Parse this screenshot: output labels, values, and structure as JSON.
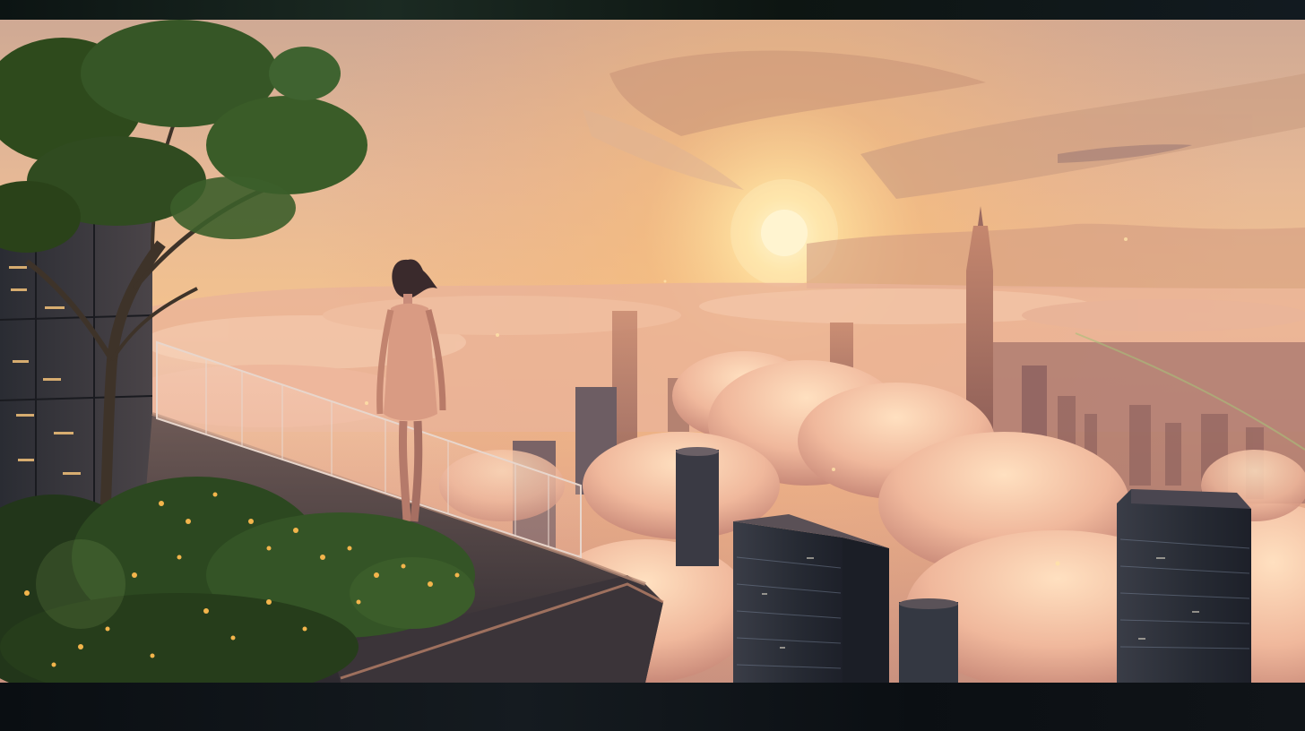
{
  "image": {
    "kind": "illustration",
    "colors": {
      "sky_top": "#d9b39a",
      "sky_glow": "#f6c27a",
      "sun": "#fff3c9",
      "cloud": "#f1c2a4",
      "cloud_shadow": "#c98f78",
      "city_far": "#b3806a",
      "building_dark": "#2b2f38",
      "foliage": "#2e4a1c",
      "blossom": "#f0b24a",
      "frame": "#0b0f14"
    }
  }
}
